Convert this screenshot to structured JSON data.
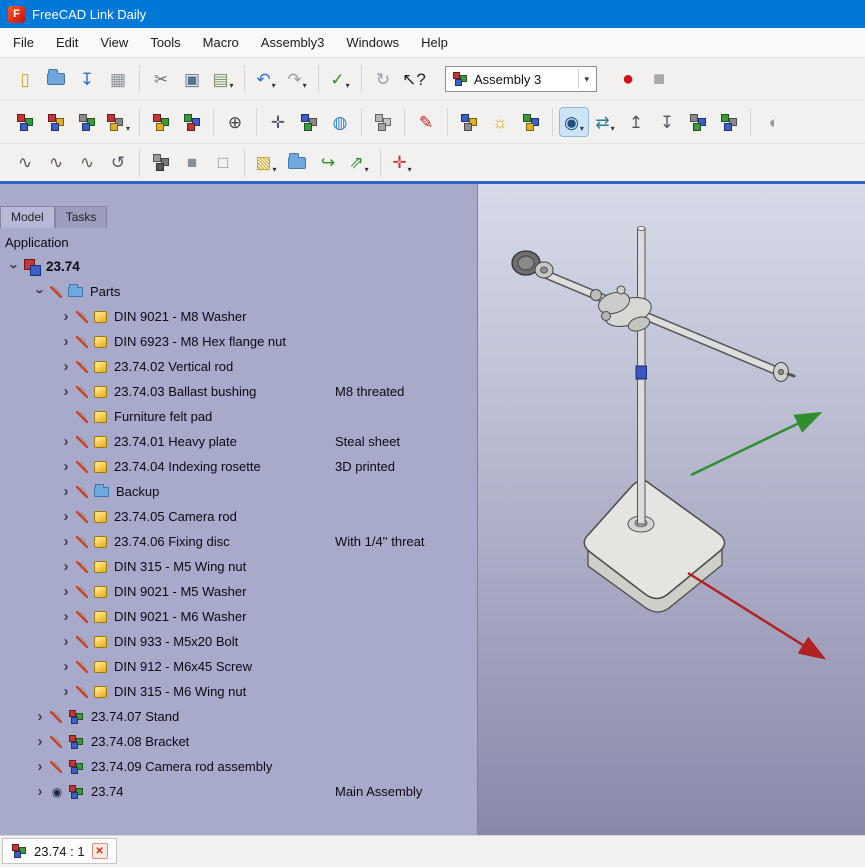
{
  "window": {
    "title": "FreeCAD Link Daily",
    "logo_letter": "F"
  },
  "menu": {
    "items": [
      "File",
      "Edit",
      "View",
      "Tools",
      "Macro",
      "Assembly3",
      "Windows",
      "Help"
    ]
  },
  "toolbar": {
    "workbench_selector": "Assembly 3"
  },
  "colors": {
    "titlebar": "#0078d7",
    "panel_bg": "#a7aacb",
    "viewport_top": "#d7dbe8",
    "viewport_bottom": "#8a88aa",
    "highlight": "#cde4f7",
    "axis_x": "#b22222",
    "axis_y": "#2f8f2f"
  },
  "toolbars": {
    "r0a": {
      "groups": [
        [
          {
            "n": "new-file-icon",
            "k": "g",
            "ch": "▯",
            "c": "#c9a227"
          },
          {
            "n": "open-file-icon",
            "k": "f"
          },
          {
            "n": "save-icon",
            "k": "g",
            "ch": "↧",
            "c": "#2f6fd0"
          },
          {
            "n": "print-icon",
            "k": "g",
            "ch": "▦",
            "c": "#8a8f98"
          }
        ],
        [
          {
            "n": "cut-icon",
            "k": "g",
            "ch": "✂",
            "c": "#6a6f78"
          },
          {
            "n": "copy-icon",
            "k": "g",
            "ch": "▣",
            "c": "#57728f"
          },
          {
            "n": "paste-icon",
            "k": "g",
            "ch": "▤",
            "c": "#7a8f6a",
            "dd": 1
          }
        ],
        [
          {
            "n": "undo-icon",
            "k": "g",
            "ch": "↶",
            "c": "#2f6fd0",
            "dd": 1
          },
          {
            "n": "redo-icon",
            "k": "g",
            "ch": "↷",
            "c": "#9aa0a8",
            "dd": 1
          }
        ],
        [
          {
            "n": "validate-icon",
            "k": "g",
            "ch": "✓",
            "c": "#2f8f2f",
            "dd": 1
          }
        ],
        [
          {
            "n": "refresh-icon",
            "k": "g",
            "ch": "↻",
            "c": "#9aa0a8"
          },
          {
            "n": "whats-this-icon",
            "k": "g",
            "ch": "↖?",
            "c": "#222"
          }
        ]
      ]
    },
    "r0b": {
      "groups": [
        [
          {
            "n": "macro-record-icon",
            "k": "g",
            "ch": "●",
            "c": "#cf1212",
            "big": 1
          },
          {
            "n": "macro-stop-icon",
            "k": "g",
            "ch": "■",
            "c": "#a8a8a8",
            "big": 1
          }
        ]
      ]
    },
    "r1": {
      "groups": [
        [
          {
            "n": "new-assembly-icon",
            "k": "c",
            "cs": [
              "#c43535",
              "#3a9a3a",
              "#3a5fc8"
            ]
          },
          {
            "n": "add-part-icon",
            "k": "c",
            "cs": [
              "#c43535",
              "#e0b020",
              "#3a5fc8"
            ]
          },
          {
            "n": "add-group-icon",
            "k": "c",
            "cs": [
              "#8a8a8a",
              "#3a9a3a",
              "#3a5fc8"
            ]
          },
          {
            "n": "new-element-icon",
            "k": "c",
            "cs": [
              "#c43535",
              "#8a8a8a",
              "#e0b020"
            ],
            "dd": 1
          }
        ],
        [
          {
            "n": "make-link-icon",
            "k": "c",
            "cs": [
              "#c43535",
              "#3a9a3a",
              "#e0b020"
            ]
          },
          {
            "n": "import-link-icon",
            "k": "c",
            "cs": [
              "#3a9a3a",
              "#3a5fc8",
              "#c43535"
            ]
          }
        ],
        [
          {
            "n": "constraint-icon",
            "k": "g",
            "ch": "⊕",
            "c": "#444"
          }
        ],
        [
          {
            "n": "move-part-icon",
            "k": "g",
            "ch": "✛",
            "c": "#556"
          },
          {
            "n": "axial-move-icon",
            "k": "c",
            "cs": [
              "#3a5fc8",
              "#8a8a8a",
              "#3a9a3a"
            ]
          },
          {
            "n": "lock-mover-icon",
            "k": "g",
            "ch": "◍",
            "c": "#2e7fc2"
          }
        ],
        [
          {
            "n": "auto-recompute-icon",
            "k": "c",
            "cs": [
              "#b5b5b5",
              "#c5c5c5",
              "#a5a5a5"
            ]
          }
        ],
        [
          {
            "n": "measure-icon",
            "k": "g",
            "ch": "✎",
            "c": "#cc2222"
          }
        ],
        [
          {
            "n": "add-workplane-icon",
            "k": "c",
            "cs": [
              "#3a5fc8",
              "#e0b020",
              "#8a8a8a"
            ]
          },
          {
            "n": "appearance-bulb-icon",
            "k": "g",
            "ch": "☼",
            "c": "#e0a000"
          },
          {
            "n": "smart-recompute-icon",
            "k": "c",
            "cs": [
              "#3a9a3a",
              "#3a5fc8",
              "#e0b020"
            ]
          }
        ],
        [
          {
            "n": "show-element-eye-icon",
            "k": "g",
            "ch": "◉",
            "c": "#1f4f7f",
            "dd": 1,
            "hl": 1
          },
          {
            "n": "move-arrows-icon",
            "k": "g",
            "ch": "⇄",
            "c": "#2a7a8f",
            "dd": 1
          },
          {
            "n": "element-up-icon",
            "k": "g",
            "ch": "↥",
            "c": "#556"
          },
          {
            "n": "element-down-icon",
            "k": "g",
            "ch": "↧",
            "c": "#556"
          },
          {
            "n": "tree-sync-icon",
            "k": "c",
            "cs": [
              "#8a8a8a",
              "#3a5fc8",
              "#3a9a3a"
            ]
          },
          {
            "n": "tree-collapse-icon",
            "k": "c",
            "cs": [
              "#3a9a3a",
              "#8a8a8a",
              "#3a5fc8"
            ]
          }
        ],
        [
          {
            "n": "misc-tool-icon",
            "k": "g",
            "ch": "◖",
            "c": "#9a9a9a"
          }
        ]
      ]
    },
    "r2": {
      "groups": [
        [
          {
            "n": "sketch-import-icon",
            "k": "g",
            "ch": "∿",
            "c": "#556"
          },
          {
            "n": "sketch-export-icon",
            "k": "g",
            "ch": "∿",
            "c": "#655"
          },
          {
            "n": "sketch-mirror-icon",
            "k": "g",
            "ch": "∿",
            "c": "#565"
          },
          {
            "n": "sketch-refresh-icon",
            "k": "g",
            "ch": "↺",
            "c": "#556"
          }
        ],
        [
          {
            "n": "map-view-icon",
            "k": "c",
            "cs": [
              "#9a9a9a",
              "#7a7a7a",
              "#5a5a5a"
            ]
          },
          {
            "n": "solid-cube-icon",
            "k": "g",
            "ch": "■",
            "c": "#8a8f98"
          },
          {
            "n": "wire-cube-icon",
            "k": "g",
            "ch": "□",
            "c": "#8a8f98"
          }
        ],
        [
          {
            "n": "part-box-icon",
            "k": "g",
            "ch": "▧",
            "c": "#d8a010",
            "dd": 1
          },
          {
            "n": "folder-icon",
            "k": "f"
          },
          {
            "n": "export-icon",
            "k": "g",
            "ch": "↪",
            "c": "#2a8f2a"
          },
          {
            "n": "share-icon",
            "k": "g",
            "ch": "⇗",
            "c": "#2a8f2a",
            "dd": 1
          }
        ],
        [
          {
            "n": "axis-cross-icon",
            "k": "g",
            "ch": "✛",
            "c": "#c43535",
            "dd": 1
          }
        ]
      ]
    }
  },
  "panel": {
    "tabs": [
      {
        "label": "Model"
      },
      {
        "label": "Tasks"
      }
    ],
    "application_label": "Application",
    "tree": [
      {
        "depth": 0,
        "chevron": "open",
        "vis": "none",
        "icon": "doc",
        "label": "23.74",
        "bold": true
      },
      {
        "depth": 1,
        "chevron": "open",
        "vis": "hidden",
        "icon": "folder",
        "label": "Parts"
      },
      {
        "depth": 2,
        "chevron": "closed",
        "vis": "hidden",
        "icon": "part",
        "label": "DIN 9021 - M8 Washer"
      },
      {
        "depth": 2,
        "chevron": "closed",
        "vis": "hidden",
        "icon": "part",
        "label": "DIN 6923 - M8 Hex flange nut"
      },
      {
        "depth": 2,
        "chevron": "closed",
        "vis": "hidden",
        "icon": "part",
        "label": "23.74.02 Vertical rod"
      },
      {
        "depth": 2,
        "chevron": "closed",
        "vis": "hidden",
        "icon": "part",
        "label": "23.74.03 Ballast bushing",
        "note": "M8 threated"
      },
      {
        "depth": 2,
        "chevron": "none",
        "vis": "hidden",
        "icon": "part",
        "label": "Furniture felt pad"
      },
      {
        "depth": 2,
        "chevron": "closed",
        "vis": "hidden",
        "icon": "part",
        "label": "23.74.01 Heavy plate",
        "note": "Steal sheet"
      },
      {
        "depth": 2,
        "chevron": "closed",
        "vis": "hidden",
        "icon": "part",
        "label": "23.74.04 Indexing rosette",
        "note": "3D printed"
      },
      {
        "depth": 2,
        "chevron": "closed",
        "vis": "hidden",
        "icon": "folder",
        "label": "Backup"
      },
      {
        "depth": 2,
        "chevron": "closed",
        "vis": "hidden",
        "icon": "part",
        "label": "23.74.05 Camera rod"
      },
      {
        "depth": 2,
        "chevron": "closed",
        "vis": "hidden",
        "icon": "part",
        "label": "23.74.06 Fixing disc",
        "note": "With 1/4'' threat"
      },
      {
        "depth": 2,
        "chevron": "closed",
        "vis": "hidden",
        "icon": "part",
        "label": "DIN 315 - M5 Wing nut"
      },
      {
        "depth": 2,
        "chevron": "closed",
        "vis": "hidden",
        "icon": "part",
        "label": "DIN 9021 - M5 Washer"
      },
      {
        "depth": 2,
        "chevron": "closed",
        "vis": "hidden",
        "icon": "part",
        "label": "DIN 9021 - M6 Washer"
      },
      {
        "depth": 2,
        "chevron": "closed",
        "vis": "hidden",
        "icon": "part",
        "label": "DIN 933 - M5x20 Bolt"
      },
      {
        "depth": 2,
        "chevron": "closed",
        "vis": "hidden",
        "icon": "part",
        "label": "DIN 912 - M6x45 Screw"
      },
      {
        "depth": 2,
        "chevron": "closed",
        "vis": "hidden",
        "icon": "part",
        "label": "DIN 315 - M6 Wing nut"
      },
      {
        "depth": 1,
        "chevron": "closed",
        "vis": "hidden",
        "icon": "asm",
        "label": "23.74.07 Stand"
      },
      {
        "depth": 1,
        "chevron": "closed",
        "vis": "hidden",
        "icon": "asm",
        "label": "23.74.08 Bracket"
      },
      {
        "depth": 1,
        "chevron": "closed",
        "vis": "hidden",
        "icon": "asm",
        "label": "23.74.09 Camera rod assembly"
      },
      {
        "depth": 1,
        "chevron": "closed",
        "vis": "visible",
        "icon": "asm",
        "label": "23.74",
        "note": "Main Assembly"
      }
    ]
  },
  "statusbar": {
    "document_tab": "23.74 : 1"
  }
}
